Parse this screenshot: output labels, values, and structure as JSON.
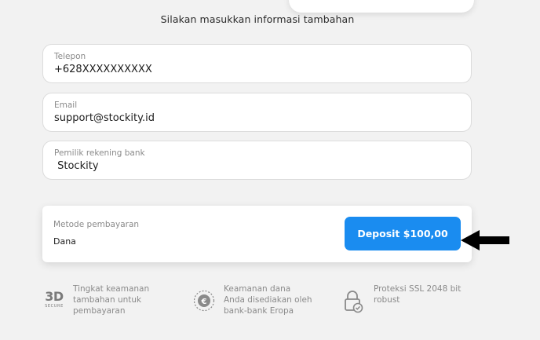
{
  "heading": "Silakan masukkan informasi tambahan",
  "fields": {
    "phone": {
      "label": "Telepon",
      "value": "+628XXXXXXXXXX"
    },
    "email": {
      "label": "Email",
      "value": "support@stockity.id"
    },
    "account_holder": {
      "label": "Pemilik rekening bank",
      "value": " Stockity"
    }
  },
  "payment": {
    "label": "Metode pembayaran",
    "value": "Dana",
    "deposit_button": "Deposit $100,00"
  },
  "features": {
    "secure3d": {
      "icon": "3d-secure-icon",
      "icon_big": "3D",
      "icon_small": "SECURE",
      "text": "Tingkat keamanan tambahan untuk pembayaran"
    },
    "eu_bank": {
      "icon": "euro-coin-icon",
      "text": "Keamanan dana Anda disediakan oleh bank-bank Eropa"
    },
    "ssl": {
      "icon": "lock-check-icon",
      "text": "Proteksi SSL 2048 bit robust"
    }
  },
  "colors": {
    "accent": "#1a8cf0",
    "background": "#f2f2f2",
    "muted_text": "#8a8a8a"
  }
}
